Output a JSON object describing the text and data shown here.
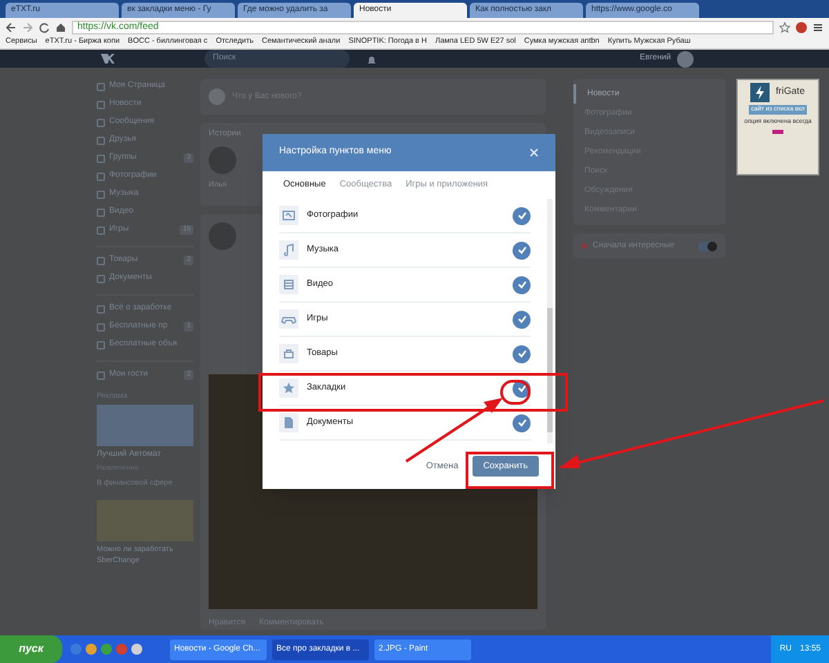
{
  "browser": {
    "tabs": [
      {
        "title": "eTXT.ru",
        "selected": false
      },
      {
        "title": "вк закладки меню - Гу",
        "selected": false
      },
      {
        "title": "Где можно удалить за",
        "selected": false
      },
      {
        "title": "Новости",
        "selected": true
      },
      {
        "title": "Как полностью закл",
        "selected": false
      },
      {
        "title": "https://www.google.co",
        "selected": false
      }
    ],
    "url": "https://vk.com/feed",
    "bookmarks": [
      "Сервисы",
      "eTXT.ru - Биржа копи",
      "BOCC - биллинговая с",
      "Отследить",
      "Семантический анали",
      "SINOPTIK: Погода в Н",
      "Лампа LED 5W E27 sol",
      "Сумка мужская antbn",
      "Купить Мужская Рубаш"
    ]
  },
  "header": {
    "search_placeholder": "Поиск",
    "user_name": "Евгений"
  },
  "left_menu": [
    [
      {
        "label": "Моя Страница"
      },
      {
        "label": "Новости"
      },
      {
        "label": "Сообщения"
      },
      {
        "label": "Друзья"
      },
      {
        "label": "Группы",
        "count": "3"
      },
      {
        "label": "Фотографии"
      },
      {
        "label": "Музыка"
      },
      {
        "label": "Видео"
      },
      {
        "label": "Игры",
        "count": "15"
      }
    ],
    [
      {
        "label": "Товары",
        "count": "2"
      },
      {
        "label": "Документы"
      }
    ],
    [
      {
        "label": "Всё о заработке"
      },
      {
        "label": "Бесплатные пр",
        "count": "1"
      },
      {
        "label": "Бесплатные объя"
      }
    ],
    [
      {
        "label": "Мои гости",
        "count": "2"
      }
    ]
  ],
  "ads": {
    "title": "Реклама",
    "items": [
      {
        "title": "Лучший Автомат",
        "subtitle": "Развлечения",
        "text": "В финансовой сфере"
      },
      {
        "title": "Можно ли заработать SberChange"
      }
    ]
  },
  "feed": {
    "composer_placeholder": "Что у Вас нового?",
    "stories_title": "Истории",
    "story_name": "Илья",
    "post_actions": [
      "Нравится",
      "Комментировать"
    ]
  },
  "right_menu": {
    "items": [
      {
        "label": "Новости",
        "selected": true
      },
      {
        "label": "Фотографии",
        "selected": false
      },
      {
        "label": "Видеозаписи",
        "selected": false
      },
      {
        "label": "Рекомендации",
        "selected": false
      },
      {
        "label": "Поиск",
        "selected": false
      },
      {
        "label": "Обсуждения",
        "selected": false
      },
      {
        "label": "Комментарии",
        "selected": false
      }
    ],
    "toggle": {
      "label": "Сначала интересные",
      "on": true
    }
  },
  "frigate": {
    "title": "friGate",
    "status": "сайт из списка вкл",
    "note": "опция включена всегда"
  },
  "modal": {
    "title": "Настройка пунктов меню",
    "tabs": [
      {
        "label": "Основные",
        "selected": true
      },
      {
        "label": "Сообщества",
        "selected": false
      },
      {
        "label": "Игры и приложения",
        "selected": false
      }
    ],
    "items": [
      {
        "label": "Фотографии",
        "kind": "photo",
        "checked": true
      },
      {
        "label": "Музыка",
        "kind": "music",
        "checked": true
      },
      {
        "label": "Видео",
        "kind": "video",
        "checked": true
      },
      {
        "label": "Игры",
        "kind": "games",
        "checked": true
      },
      {
        "label": "Товары",
        "kind": "goods",
        "checked": true
      },
      {
        "label": "Закладки",
        "kind": "bookmarks",
        "checked": true
      },
      {
        "label": "Документы",
        "kind": "documents",
        "checked": true
      }
    ],
    "cancel": "Отмена",
    "save": "Сохранить"
  },
  "taskbar": {
    "start": "пуск",
    "windows": [
      {
        "title": "Новости - Google Ch...",
        "selected": false
      },
      {
        "title": "Все про закладки в ...",
        "selected": true
      },
      {
        "title": "2.JPG - Paint",
        "selected": false
      }
    ],
    "language": "RU",
    "time": "13:55"
  }
}
